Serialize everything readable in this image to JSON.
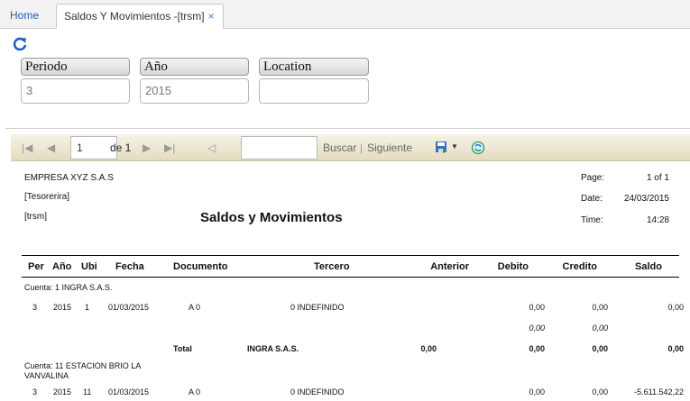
{
  "tabs": {
    "home": "Home",
    "report": "Saldos Y Movimientos -[trsm]",
    "close": "×"
  },
  "params": {
    "periodo_label": "Periodo",
    "periodo_value": "3",
    "anio_label": "Año",
    "anio_value": "2015",
    "location_label": "Location",
    "location_value": ""
  },
  "toolbar": {
    "page_value": "1",
    "of_label": "de 1",
    "find_label": "Buscar",
    "sep": "|",
    "next_label": "Siguiente"
  },
  "report": {
    "company": "EMPRESA XYZ S.A.S",
    "dept": "[Tesorerira]",
    "user": "[trsm]",
    "title": "Saldos y Movimientos",
    "page_label": "Page:",
    "page_value": "1 of 1",
    "date_label": "Date:",
    "date_value": "24/03/2015",
    "time_label": "Time:",
    "time_value": "14:28",
    "columns": [
      "Per",
      "Año",
      "Ubi",
      "Fecha",
      "Documento",
      "Tercero",
      "Anterior",
      "Debito",
      "Credito",
      "Saldo"
    ],
    "cuenta1": "Cuenta: 1  INGRA S.A.S.",
    "row1": {
      "per": "3",
      "anio": "2015",
      "ubi": "1",
      "fecha": "01/03/2015",
      "doc": "A 0",
      "tercero": "0 INDEFINIDO",
      "debito": "0,00",
      "credito": "0,00",
      "saldo": "0,00"
    },
    "sub1": {
      "debito": "0,00",
      "credito": "0,00"
    },
    "total1": {
      "label": "Total",
      "name": "INGRA S.A.S.",
      "anterior": "0,00",
      "debito": "0,00",
      "credito": "0,00",
      "saldo": "0,00"
    },
    "cuenta2_line1": "Cuenta: 11  ESTACION BRIO LA",
    "cuenta2_line2": "VANVALINA",
    "row2": {
      "per": "3",
      "anio": "2015",
      "ubi": "11",
      "fecha": "01/03/2015",
      "doc": "A 0",
      "tercero": "0 INDEFINIDO",
      "debito": "0,00",
      "credito": "0,00",
      "saldo": "-5.611.542,22"
    }
  }
}
